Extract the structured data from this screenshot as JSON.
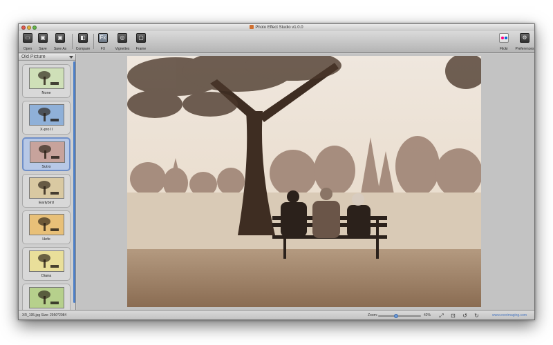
{
  "window": {
    "title": "Photo Effect Studio v1.0.0"
  },
  "toolbar": {
    "open": "Open",
    "save": "Save",
    "save_as": "Save As",
    "compare": "Compare",
    "fx": "FX",
    "fx_icon": "Fx",
    "vignettes": "Vignettes",
    "frame": "Frame",
    "flickr": "Flickr",
    "preferences": "Preferences"
  },
  "sidebar": {
    "category": "Old Picture",
    "selected": "Sutro",
    "effects": [
      {
        "label": "None",
        "tint": "#cfe0b8"
      },
      {
        "label": "X-pro II",
        "tint": "#8fb0d8"
      },
      {
        "label": "Sutro",
        "tint": "#c7a39c"
      },
      {
        "label": "Earlybird",
        "tint": "#d9c9a2"
      },
      {
        "label": "Hefe",
        "tint": "#e8c078"
      },
      {
        "label": "Diana",
        "tint": "#e9df9a"
      },
      {
        "label": "",
        "tint": "#b6d08c"
      }
    ]
  },
  "statusbar": {
    "file_info": "XR_195.jpg   Size: 2950*2084",
    "zoom_label": "Zoom:",
    "zoom_value": "42%",
    "zoom_level": 0.42,
    "website": "www.everimaging.com"
  },
  "colors": {
    "accent": "#4d7fc7",
    "selection": "#b7c8e6"
  },
  "icons": [
    "open-icon",
    "save-icon",
    "save-as-icon",
    "compare-icon",
    "fx-icon",
    "vignettes-icon",
    "frame-icon",
    "flickr-icon",
    "gear-icon",
    "fit-icon",
    "actual-size-icon",
    "rotate-left-icon",
    "rotate-right-icon"
  ]
}
